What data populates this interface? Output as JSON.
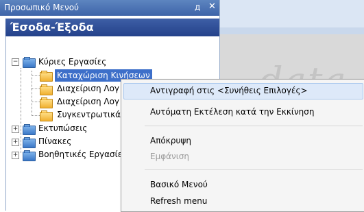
{
  "panel": {
    "title": "Προσωπικό Μενού",
    "pin_glyph": "д",
    "close_glyph": "✕"
  },
  "header": {
    "text": "Έσοδα-Έξοδα"
  },
  "tree": [
    {
      "label": "Κύριες Εργασίες",
      "expander": "−"
    },
    {
      "label": "Καταχώριση Κινήσεων"
    },
    {
      "label": "Διαχείριση Λογ"
    },
    {
      "label": "Διαχείριση Λογ"
    },
    {
      "label": "Συγκεντρωτικά"
    },
    {
      "label": "Εκτυπώσεις",
      "expander": "+"
    },
    {
      "label": "Πίνακες",
      "expander": "+"
    },
    {
      "label": "Βοηθητικές Εργασίες",
      "expander": "+"
    }
  ],
  "context_menu": {
    "items": [
      {
        "label": "Αντιγραφή στις <Συνήθεις Επιλογές>"
      },
      {
        "label": "Αυτόματη Εκτέλεση κατά την Εκκίνηση"
      },
      {
        "label": "Απόκρυψη"
      },
      {
        "label": "Εμφάνιση"
      },
      {
        "label": "Βασικό Μενού"
      },
      {
        "label": "Refresh menu"
      }
    ]
  },
  "background": {
    "watermark": "data"
  }
}
